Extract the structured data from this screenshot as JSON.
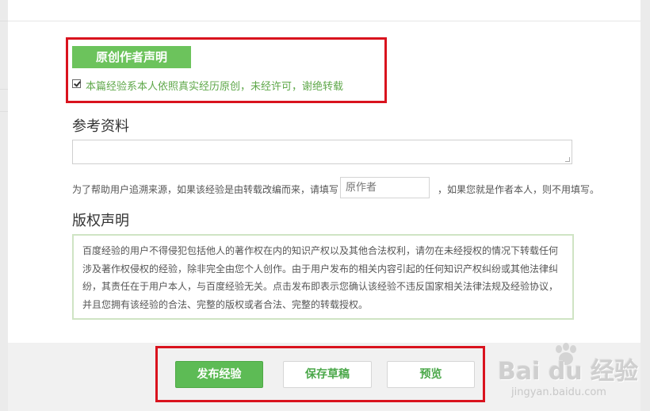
{
  "declaration": {
    "button_label": "原创作者声明",
    "checkbox_checked": true,
    "checkbox_text": "本篇经验系本人依照真实经历原创，未经许可，谢绝转载"
  },
  "reference": {
    "title": "参考资料",
    "help_before": "为了帮助用户追溯来源，如果该经验是由转载改编而来，请填写",
    "author_placeholder": "原作者",
    "help_after": "，如果您就是作者本人，则不用填写。"
  },
  "copyright": {
    "title": "版权声明",
    "lines": [
      "百度经验的用户不得侵犯包括他人的著作权在内的知识产权以及其他合法权利，请勿在未经授权的情况下转载任何",
      "涉及著作权侵权的经验，除非完全由您个人创作。由于用户发布的相关内容引起的任何知识产权纠纷或其他法律纠",
      "纷，其责任在于用户本人，与百度经验无关。点击发布即表示您确认该经验不违反国家相关法律法规及经验协议，",
      "并且您拥有该经验的合法、完整的版权或者合法、完整的转载授权。"
    ]
  },
  "actions": {
    "publish": "发布经验",
    "save_draft": "保存草稿",
    "preview": "预览"
  },
  "watermark": {
    "brand": "Bai du 经验",
    "url": "jingyan.baidu.com"
  },
  "colors": {
    "accent_green": "#6cc35c",
    "highlight_red": "#d9131e"
  }
}
